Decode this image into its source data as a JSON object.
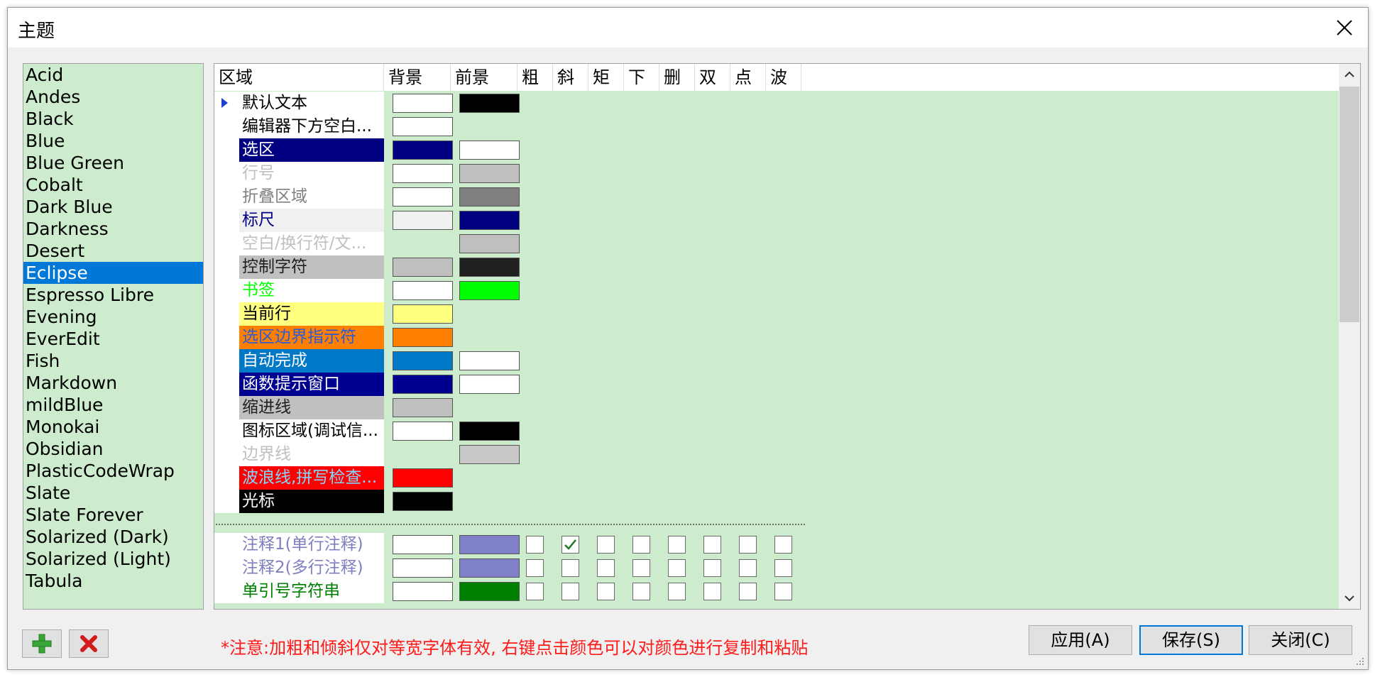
{
  "window": {
    "title": "主题",
    "close_icon": "close-icon"
  },
  "themes": {
    "selected": "Eclipse",
    "items": [
      "Acid",
      "Andes",
      "Black",
      "Blue",
      "Blue Green",
      "Cobalt",
      "Dark Blue",
      "Darkness",
      "Desert",
      "Eclipse",
      "Espresso Libre",
      "Evening",
      "EverEdit",
      "Fish",
      "Markdown",
      "mildBlue",
      "Monokai",
      "Obsidian",
      "PlasticCodeWrap",
      "Slate",
      "Slate Forever",
      "Solarized (Dark)",
      "Solarized (Light)",
      "Tabula"
    ]
  },
  "grid": {
    "headers": [
      "区域",
      "背景",
      "前景",
      "粗",
      "斜",
      "矩",
      "下",
      "删",
      "双",
      "点",
      "波"
    ],
    "rows": [
      {
        "name": "默认文本",
        "fg_text": "#000000",
        "bg_text": "#ffffff",
        "bg": "#ffffff",
        "fg": "#000000",
        "current": true
      },
      {
        "name": "编辑器下方空白...",
        "fg_text": "#000000",
        "bg_text": "#ffffff",
        "bg": "#ffffff",
        "fg": null
      },
      {
        "name": "选区",
        "fg_text": "#ffffff",
        "bg_text": "#000080",
        "bg": "#000080",
        "fg": "#ffffff"
      },
      {
        "name": "行号",
        "fg_text": "#c0c0c0",
        "bg_text": "#ffffff",
        "bg": "#ffffff",
        "fg": "#c0c0c0"
      },
      {
        "name": "折叠区域",
        "fg_text": "#808080",
        "bg_text": "#ffffff",
        "bg": "#ffffff",
        "fg": "#808080"
      },
      {
        "name": "标尺",
        "fg_text": "#000080",
        "bg_text": "#f0f0f0",
        "bg": "#f0f0f0",
        "fg": "#000080"
      },
      {
        "name": "空白/换行符/文...",
        "fg_text": "#c0c0c0",
        "bg_text": "#ffffff",
        "bg": null,
        "fg": "#c0c0c0"
      },
      {
        "name": "控制字符",
        "fg_text": "#202020",
        "bg_text": "#c0c0c0",
        "bg": "#c0c0c0",
        "fg": "#202020"
      },
      {
        "name": "书签",
        "fg_text": "#00ff00",
        "bg_text": "#ffffff",
        "bg": "#ffffff",
        "fg": "#00ff00"
      },
      {
        "name": "当前行",
        "fg_text": "#000000",
        "bg_text": "#ffff80",
        "bg": "#ffff80",
        "fg": null
      },
      {
        "name": "选区边界指示符",
        "fg_text": "#2a5bd7",
        "bg_text": "#ff8000",
        "bg": "#ff8000",
        "fg": null
      },
      {
        "name": "自动完成",
        "fg_text": "#ffffff",
        "bg_text": "#0078c8",
        "bg": "#0078c8",
        "fg": "#ffffff"
      },
      {
        "name": "函数提示窗口",
        "fg_text": "#ffffff",
        "bg_text": "#000090",
        "bg": "#000090",
        "fg": "#ffffff"
      },
      {
        "name": "缩进线",
        "fg_text": "#202020",
        "bg_text": "#c0c0c0",
        "bg": "#c0c0c0",
        "fg": null
      },
      {
        "name": "图标区域(调试信...",
        "fg_text": "#000000",
        "bg_text": "#ffffff",
        "bg": "#ffffff",
        "fg": "#000000"
      },
      {
        "name": "边界线",
        "fg_text": "#c0c0c0",
        "bg_text": "#ffffff",
        "bg": null,
        "fg": "#c8c8c8"
      },
      {
        "name": "波浪线,拼写检查...",
        "fg_text": "#80d8ff",
        "bg_text": "#ff0000",
        "bg": "#ff0000",
        "fg": null
      },
      {
        "name": "光标",
        "fg_text": "#ffffff",
        "bg_text": "#000000",
        "bg": "#000000",
        "fg": null
      }
    ],
    "style_rows": [
      {
        "name": "注释1(单行注释)",
        "fg_text": "#7f7fbf",
        "bg": "#ffffff",
        "fg": "#8080c8",
        "checks": [
          false,
          true,
          false,
          false,
          false,
          false,
          false,
          false
        ]
      },
      {
        "name": "注释2(多行注释)",
        "fg_text": "#7f7fbf",
        "bg": "#ffffff",
        "fg": "#8080c8",
        "checks": [
          false,
          false,
          false,
          false,
          false,
          false,
          false,
          false
        ]
      },
      {
        "name": "单引号字符串",
        "fg_text": "#008000",
        "bg": "#ffffff",
        "fg": "#008000",
        "checks": [
          false,
          false,
          false,
          false,
          false,
          false,
          false,
          false
        ]
      }
    ]
  },
  "toolbar": {
    "add_icon": "add-icon",
    "delete_icon": "delete-icon"
  },
  "note": "*注意:加粗和倾斜仅对等宽字体有效, 右键点击颜色可以对颜色进行复制和粘贴",
  "buttons": {
    "apply": "应用(A)",
    "save": "保存(S)",
    "close": "关闭(C)"
  }
}
